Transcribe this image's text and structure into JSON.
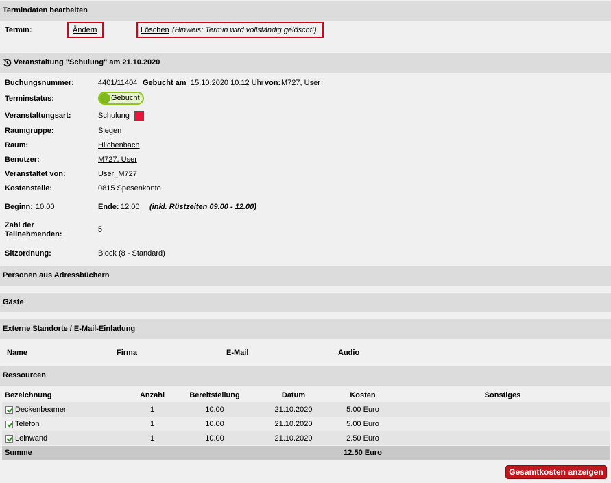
{
  "termindaten": {
    "header": "Termindaten bearbeiten",
    "termin_label": "Termin:",
    "aendern_link": "Ändern",
    "loeschen_link": "Löschen",
    "loeschen_hint": "(Hinweis: Termin wird vollständig gelöscht!)"
  },
  "veranstaltung": {
    "header": "Veranstaltung \"Schulung\" am 21.10.2020",
    "icon": "history-icon",
    "buchungsnummer_label": "Buchungsnummer:",
    "buchungsnummer": "4401/11404",
    "gebucht_am_label": "Gebucht am",
    "gebucht_am": "15.10.2020 10.12 Uhr",
    "von_label": "von:",
    "von": "M727, User",
    "terminstatus_label": "Terminstatus:",
    "terminstatus": "Gebucht",
    "veranstaltungsart_label": "Veranstaltungsart:",
    "veranstaltungsart": "Schulung",
    "veranstaltungsart_color": "#e8173b",
    "raumgruppe_label": "Raumgruppe:",
    "raumgruppe": "Siegen",
    "raum_label": "Raum:",
    "raum": "Hilchenbach",
    "benutzer_label": "Benutzer:",
    "benutzer": "M727, User",
    "veranstaltet_von_label": "Veranstaltet von:",
    "veranstaltet_von": "User_M727",
    "kostenstelle_label": "Kostenstelle:",
    "kostenstelle": "0815 Spesenkonto",
    "beginn_label": "Beginn:",
    "beginn": "10.00",
    "ende_label": "Ende:",
    "ende": "12.00",
    "ruestzeiten": "(inkl. Rüstzeiten 09.00 - 12.00)",
    "teilnehmer_label_1": "Zahl der",
    "teilnehmer_label_2": "Teilnehmenden:",
    "teilnehmer": "5",
    "sitzordnung_label": "Sitzordnung:",
    "sitzordnung": "Block (8 - Standard)"
  },
  "personen": {
    "header": "Personen aus Adressbüchern"
  },
  "gaeste": {
    "header": "Gäste"
  },
  "extern": {
    "header": "Externe Standorte / E-Mail-Einladung",
    "columns": [
      "Name",
      "Firma",
      "E-Mail",
      "Audio"
    ]
  },
  "ressourcen": {
    "header": "Ressourcen",
    "columns": [
      "Bezeichnung",
      "Anzahl",
      "Bereitstellung",
      "Datum",
      "Kosten",
      "Sonstiges"
    ],
    "rows": [
      {
        "name": "Deckenbeamer",
        "anzahl": "1",
        "bereitstellung": "10.00",
        "datum": "21.10.2020",
        "kosten": "5.00 Euro",
        "checked": true
      },
      {
        "name": "Telefon",
        "anzahl": "1",
        "bereitstellung": "10.00",
        "datum": "21.10.2020",
        "kosten": "5.00 Euro",
        "checked": true
      },
      {
        "name": "Leinwand",
        "anzahl": "1",
        "bereitstellung": "10.00",
        "datum": "21.10.2020",
        "kosten": "2.50 Euro",
        "checked": true
      }
    ],
    "summe_label": "Summe",
    "summe": "12.50 Euro"
  },
  "gesamtkosten_button": "Gesamtkosten anzeigen"
}
